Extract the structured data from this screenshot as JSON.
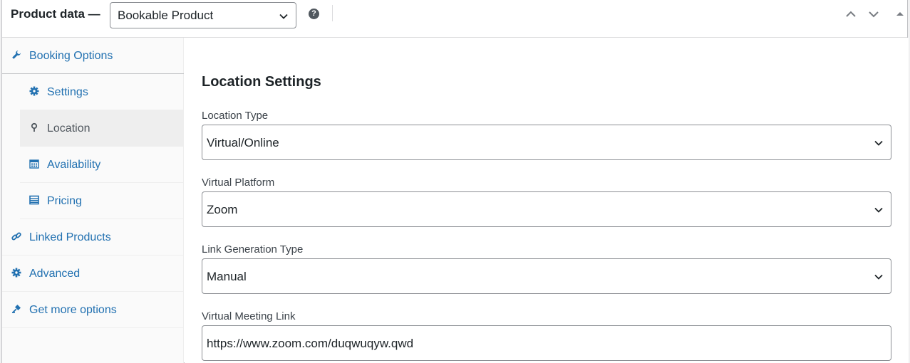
{
  "header": {
    "title": "Product data —",
    "product_type": "Bookable Product",
    "help": "?"
  },
  "sidebar": {
    "items": [
      {
        "label": "Booking Options",
        "icon": "wrench-icon"
      },
      {
        "label": "Settings",
        "icon": "gear-icon"
      },
      {
        "label": "Location",
        "icon": "location-pin-icon"
      },
      {
        "label": "Availability",
        "icon": "calendar-icon"
      },
      {
        "label": "Pricing",
        "icon": "list-icon"
      },
      {
        "label": "Linked Products",
        "icon": "link-icon"
      },
      {
        "label": "Advanced",
        "icon": "gear-icon"
      },
      {
        "label": "Get more options",
        "icon": "plug-icon"
      }
    ]
  },
  "main": {
    "section_title": "Location Settings",
    "fields": [
      {
        "label": "Location Type",
        "value": "Virtual/Online"
      },
      {
        "label": "Virtual Platform",
        "value": "Zoom"
      },
      {
        "label": "Link Generation Type",
        "value": "Manual"
      },
      {
        "label": "Virtual Meeting Link",
        "value": "https://www.zoom.com/duqwuqyw.qwd"
      }
    ]
  },
  "colors": {
    "link": "#2271b1",
    "border": "#8c8f94",
    "active_tab_bg": "#eeeeee"
  }
}
